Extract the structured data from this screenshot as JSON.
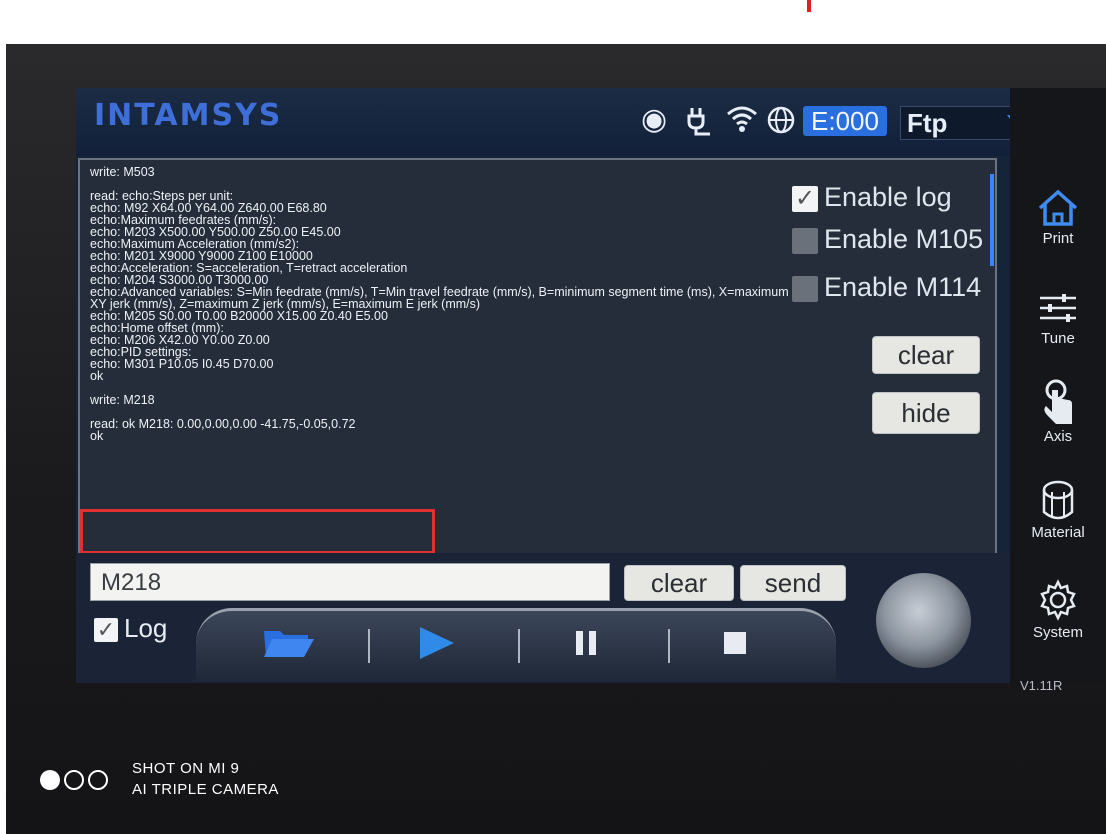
{
  "header": {
    "brand": "INTAMSYS",
    "extruder_status": "E:000",
    "connection_mode": "Ftp"
  },
  "console": {
    "lines": [
      "write: M503",
      "",
      "read: echo:Steps per unit:",
      "echo:  M92 X64.00 Y64.00 Z640.00 E68.80",
      "echo:Maximum feedrates (mm/s):",
      "echo:  M203 X500.00 Y500.00 Z50.00 E45.00",
      "echo:Maximum Acceleration (mm/s2):",
      "echo:  M201 X9000 Y9000 Z100 E10000",
      "echo:Acceleration: S=acceleration, T=retract acceleration",
      "echo:  M204 S3000.00 T3000.00",
      "echo:Advanced variables: S=Min feedrate (mm/s), T=Min travel feedrate (mm/s), B=minimum segment time (ms), X=maximum",
      "XY jerk (mm/s),  Z=maximum Z jerk (mm/s),  E=maximum E jerk (mm/s)",
      "echo:  M205 S0.00 T0.00 B20000 X15.00 Z0.40 E5.00",
      "echo:Home offset (mm):",
      "echo:  M206 X42.00 Y0.00 Z0.00",
      "echo:PID settings:",
      "echo:  M301 P10.05 I0.45 D70.00",
      "ok",
      "",
      "write: M218",
      "",
      "read: ok M218: 0.00,0.00,0.00 -41.75,-0.05,0.72",
      "ok"
    ],
    "enable_log_label": "Enable log",
    "enable_m105_label": "Enable M105",
    "enable_m114_label": "Enable M114",
    "clear_label": "clear",
    "hide_label": "hide"
  },
  "command_bar": {
    "input_value": "M218",
    "clear_label": "clear",
    "send_label": "send",
    "log_label": "Log"
  },
  "sidebar": {
    "items": [
      {
        "label": "Print"
      },
      {
        "label": "Tune"
      },
      {
        "label": "Axis"
      },
      {
        "label": "Material"
      },
      {
        "label": "System"
      }
    ],
    "version": "V1.11R"
  },
  "watermark": {
    "line1": "SHOT ON MI 9",
    "line2": "AI TRIPLE CAMERA"
  },
  "colors": {
    "brand_blue": "#3e6fd8",
    "accent_blue": "#2a6fe0",
    "highlight_red": "#e03030"
  }
}
